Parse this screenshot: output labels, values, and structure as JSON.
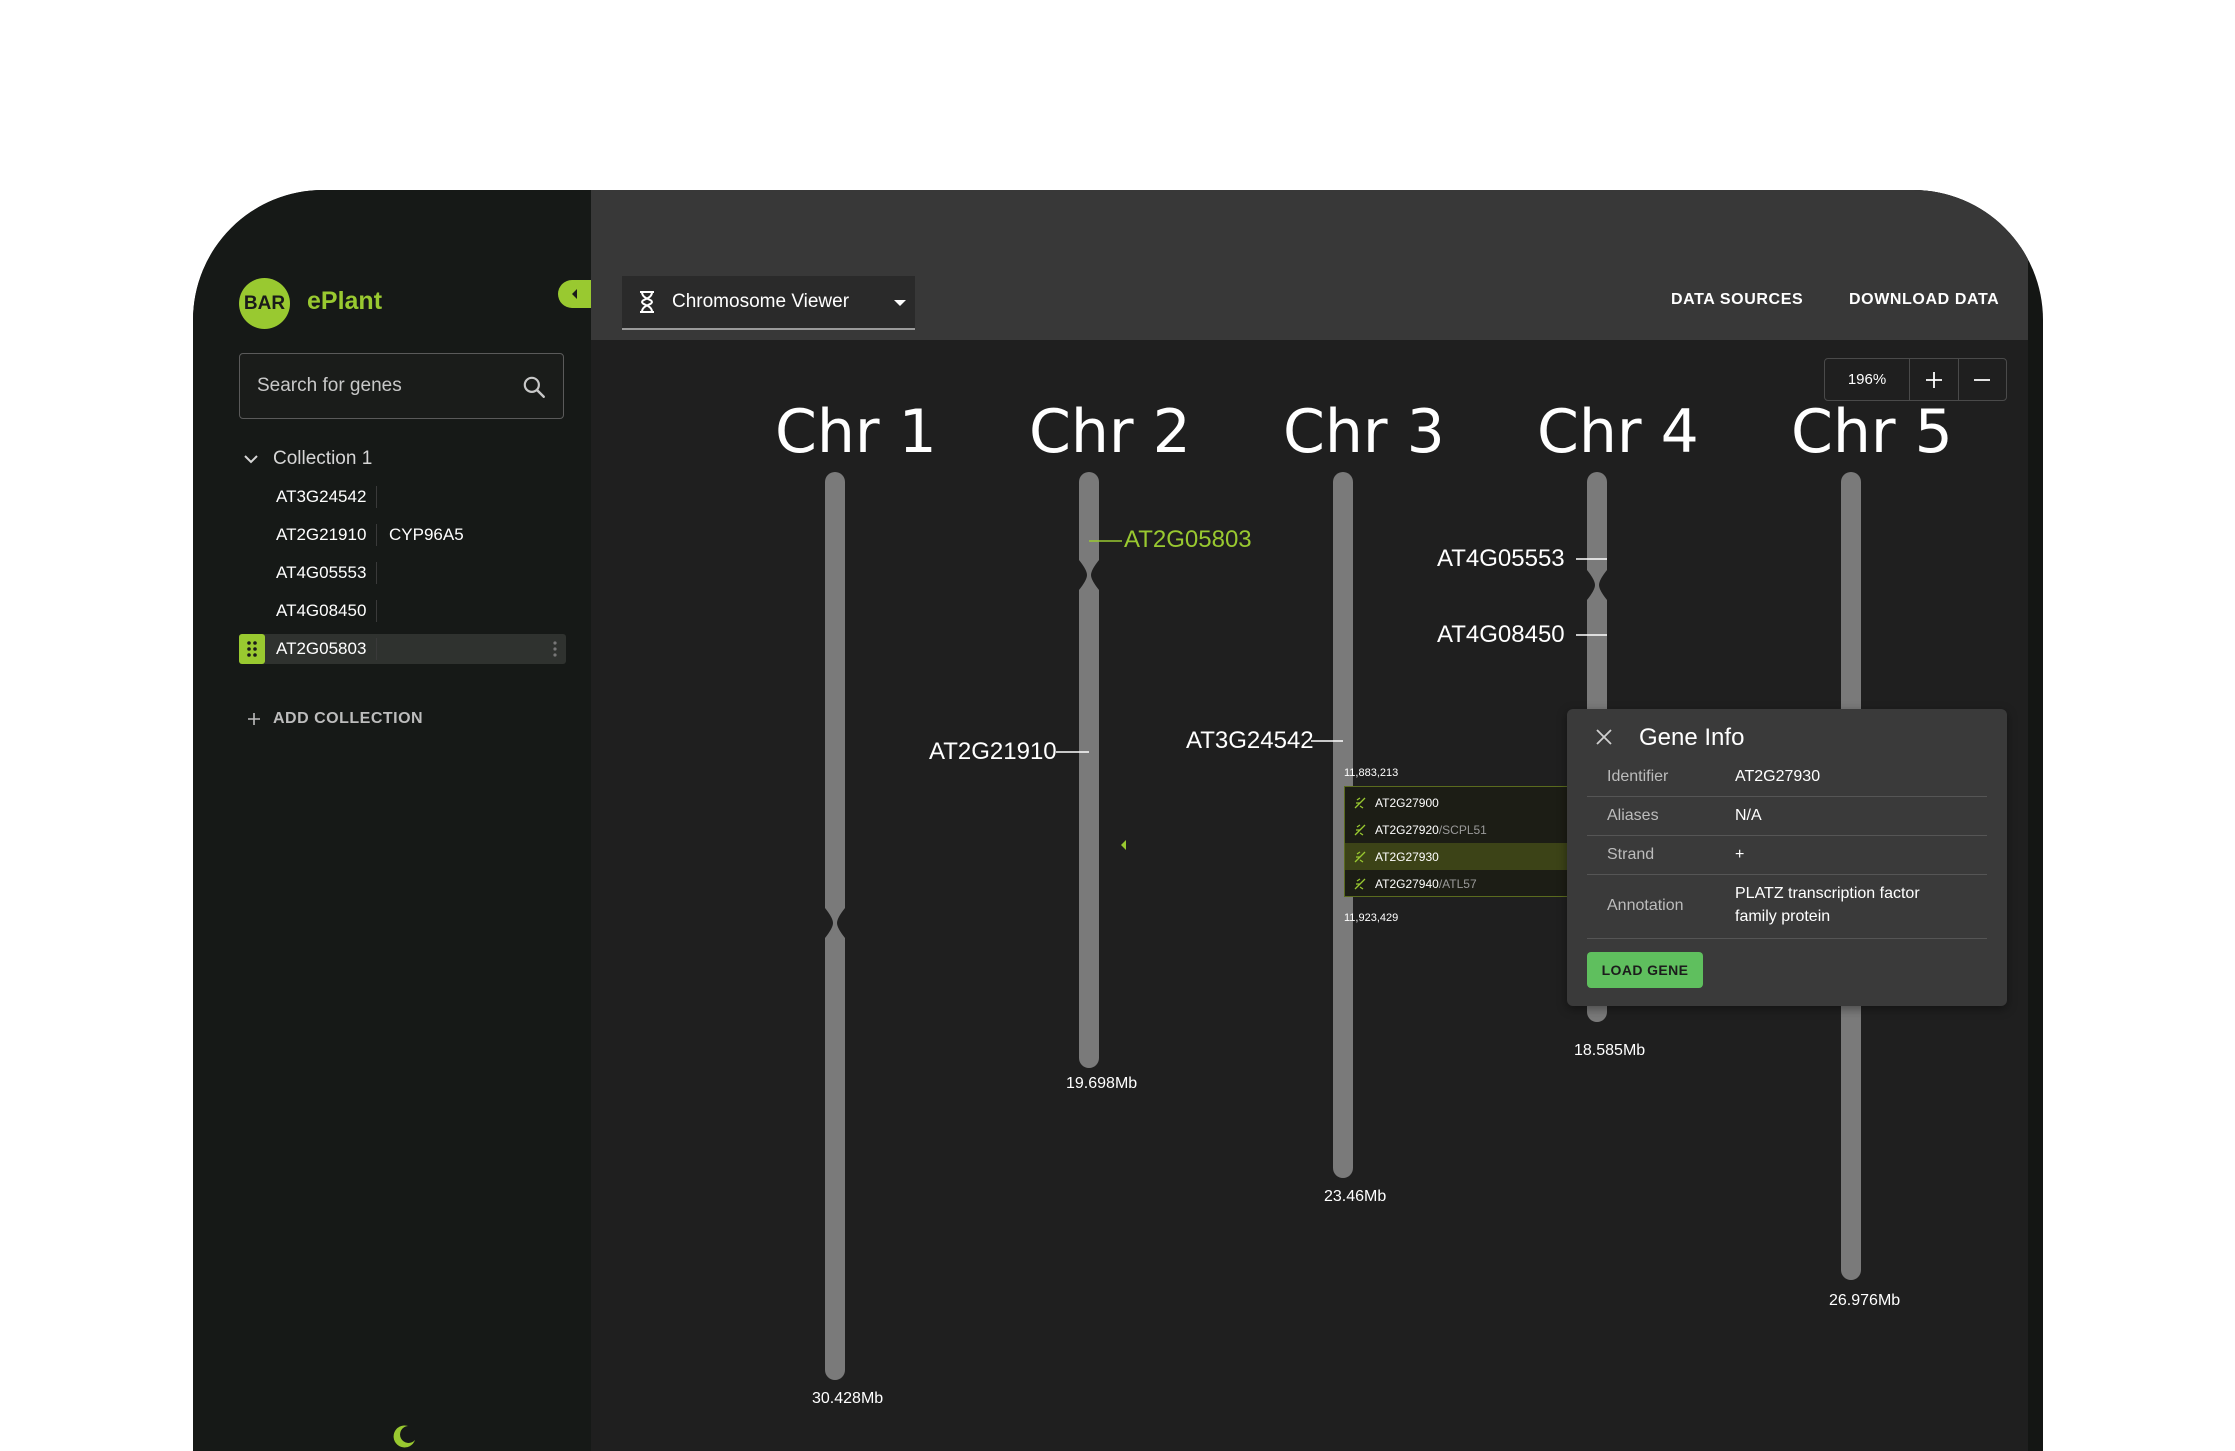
{
  "app": {
    "logo_text": "BAR",
    "name": "ePlant"
  },
  "search": {
    "placeholder": "Search for genes"
  },
  "collection": {
    "title": "Collection 1",
    "genes": [
      {
        "id": "AT3G24542",
        "alias": ""
      },
      {
        "id": "AT2G21910",
        "alias": "CYP96A5"
      },
      {
        "id": "AT4G05553",
        "alias": ""
      },
      {
        "id": "AT4G08450",
        "alias": ""
      },
      {
        "id": "AT2G05803",
        "alias": ""
      }
    ],
    "selected": "AT2G05803"
  },
  "add_collection_label": "ADD COLLECTION",
  "viewer": {
    "selected": "Chromosome Viewer"
  },
  "toolbar": {
    "data_sources": "DATA SOURCES",
    "download_data": "DOWNLOAD DATA"
  },
  "zoom": {
    "level": "196%"
  },
  "chromosomes": [
    {
      "name": "Chr 1",
      "length": "30.428Mb"
    },
    {
      "name": "Chr 2",
      "length": "19.698Mb"
    },
    {
      "name": "Chr 3",
      "length": "23.46Mb"
    },
    {
      "name": "Chr 4",
      "length": "18.585Mb"
    },
    {
      "name": "Chr 5",
      "length": "26.976Mb"
    }
  ],
  "gene_markers": [
    {
      "id": "AT2G05803",
      "chromosome": "Chr 2",
      "active": true
    },
    {
      "id": "AT2G21910",
      "chromosome": "Chr 2",
      "active": false
    },
    {
      "id": "AT3G24542",
      "chromosome": "Chr 3",
      "active": false
    },
    {
      "id": "AT4G05553",
      "chromosome": "Chr 4",
      "active": false
    },
    {
      "id": "AT4G08450",
      "chromosome": "Chr 4",
      "active": false
    }
  ],
  "region": {
    "start": "11,883,213",
    "end": "11,923,429",
    "genes": [
      {
        "id": "AT2G27900",
        "alias": ""
      },
      {
        "id": "AT2G27920",
        "alias": "/SCPL51"
      },
      {
        "id": "AT2G27930",
        "alias": ""
      },
      {
        "id": "AT2G27940",
        "alias": "/ATL57"
      }
    ],
    "highlighted": "AT2G27930"
  },
  "gene_info": {
    "title": "Gene Info",
    "rows": [
      {
        "key": "Identifier",
        "value": "AT2G27930"
      },
      {
        "key": "Aliases",
        "value": "N/A"
      },
      {
        "key": "Strand",
        "value": "+"
      },
      {
        "key": "Annotation",
        "value": "PLATZ transcription factor family protein"
      }
    ],
    "load_button": "LOAD GENE"
  },
  "colors": {
    "accent": "#99c930",
    "load_button": "#5fbf5e",
    "chromosome": "#777777"
  }
}
